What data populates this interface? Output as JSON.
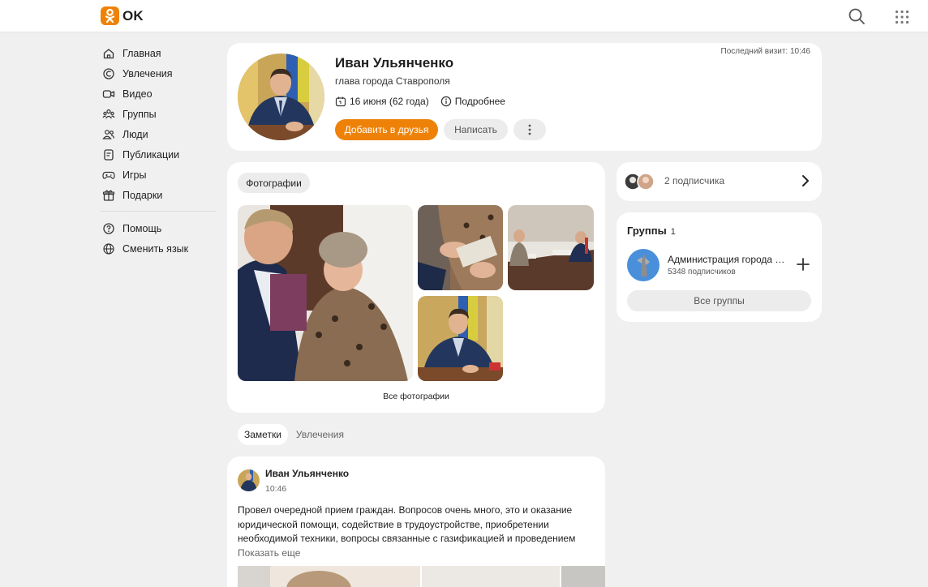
{
  "app": {
    "logo_text": "OK",
    "brand_color": "#ee8208"
  },
  "header": {
    "search_icon": "search-icon",
    "apps_icon": "grid-icon"
  },
  "sidebar": {
    "items": [
      {
        "label": "Главная",
        "icon": "home-icon"
      },
      {
        "label": "Увлечения",
        "icon": "hobby-icon"
      },
      {
        "label": "Видео",
        "icon": "video-icon"
      },
      {
        "label": "Группы",
        "icon": "groups-icon"
      },
      {
        "label": "Люди",
        "icon": "people-icon"
      },
      {
        "label": "Публикации",
        "icon": "publications-icon"
      },
      {
        "label": "Игры",
        "icon": "gamepad-icon"
      },
      {
        "label": "Подарки",
        "icon": "gift-icon"
      }
    ],
    "secondary": [
      {
        "label": "Помощь",
        "icon": "help-icon"
      },
      {
        "label": "Сменить язык",
        "icon": "globe-icon"
      }
    ]
  },
  "profile": {
    "name": "Иван Ульянченко",
    "title": "глава города Ставрополя",
    "birthday": "16 июня (62 года)",
    "more_label": "Подробнее",
    "last_visit": "Последний визит: 10:46",
    "add_friend_label": "Добавить в друзья",
    "message_label": "Написать"
  },
  "photos": {
    "chip_label": "Фотографии",
    "all_label": "Все фотографии"
  },
  "tabs": [
    {
      "label": "Заметки",
      "active": true
    },
    {
      "label": "Увлечения",
      "active": false
    }
  ],
  "post": {
    "author": "Иван Ульянченко",
    "time": "10:46",
    "text": "Провел очередной прием граждан. Вопросов очень много, это и оказание юридической помощи, содействие в трудоустройстве, приобретении необходимой техники, вопросы связанные с газификацией и проведением",
    "show_more": "Показать еще"
  },
  "subscribers": {
    "label": "2 подписчика"
  },
  "groups": {
    "title": "Группы",
    "count": "1",
    "items": [
      {
        "name": "Администрация города Ставрополя",
        "subscribers": "5348 подписчиков"
      }
    ],
    "all_label": "Все группы"
  }
}
